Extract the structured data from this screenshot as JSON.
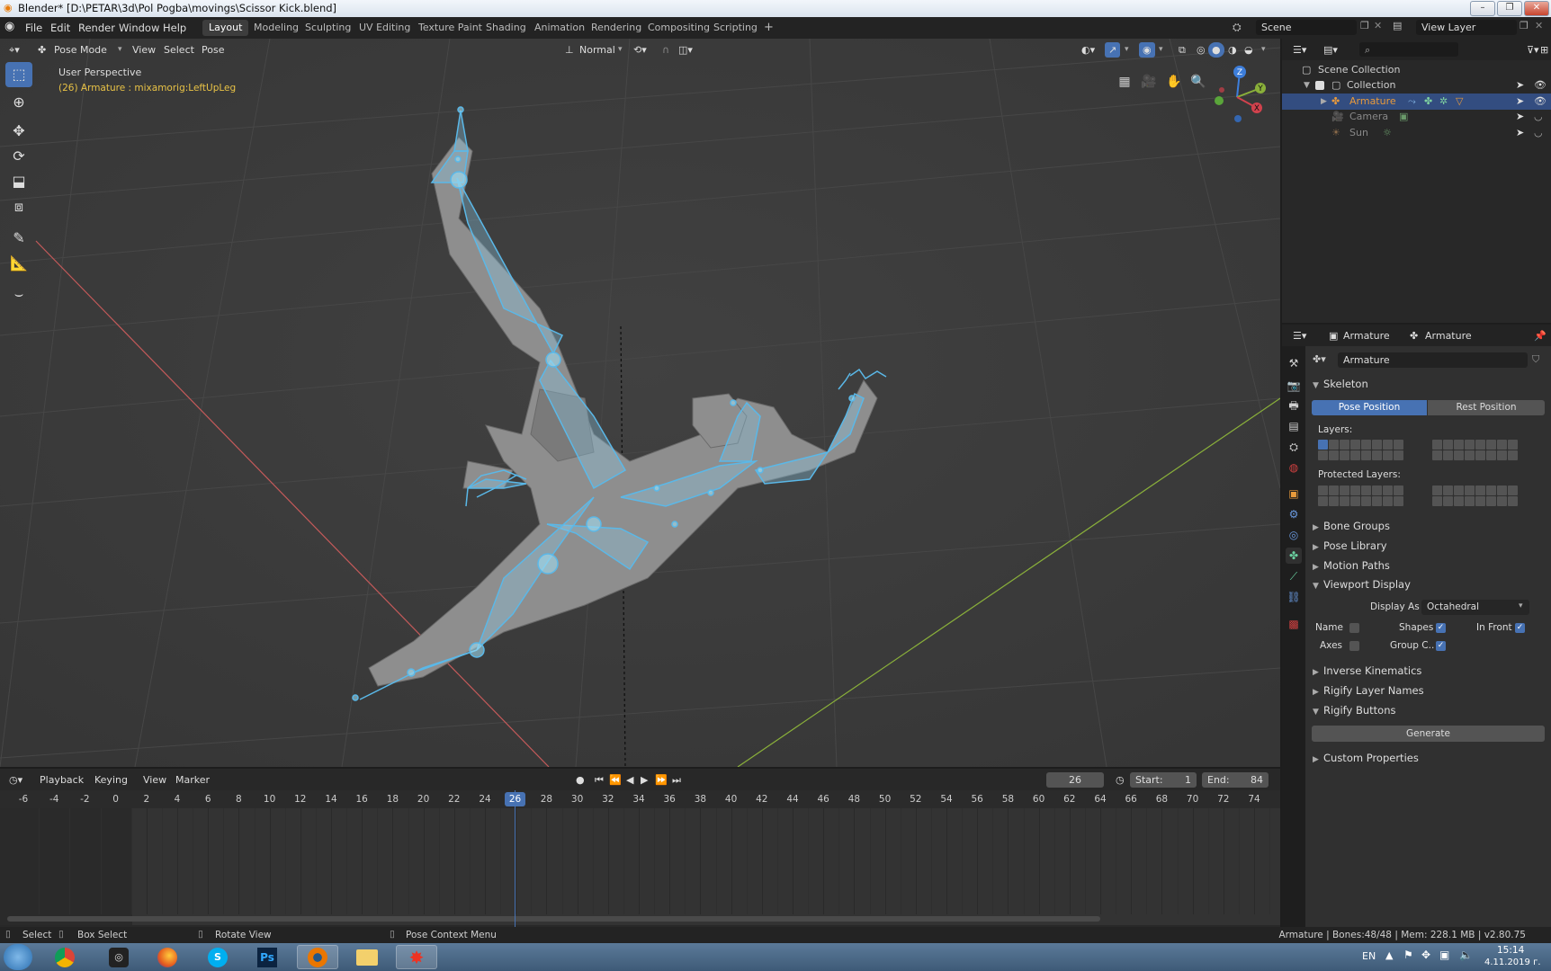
{
  "window": {
    "title": "Blender* [D:\\PETAR\\3d\\Pol Pogba\\movings\\Scissor Kick.blend]",
    "min": "–",
    "max": "❐",
    "close": "✕"
  },
  "menubar": {
    "items": [
      "File",
      "Edit",
      "Render",
      "Window",
      "Help"
    ]
  },
  "workspaces": {
    "tabs": [
      "Layout",
      "Modeling",
      "Sculpting",
      "UV Editing",
      "Texture Paint",
      "Shading",
      "Animation",
      "Rendering",
      "Compositing",
      "Scripting"
    ],
    "active": "Layout",
    "add": "+"
  },
  "scene": {
    "label": "Scene",
    "view_layer": "View Layer"
  },
  "viewport": {
    "mode": "Pose Mode",
    "menus": [
      "View",
      "Select",
      "Pose"
    ],
    "orientation": "Normal",
    "info_line1": "User Perspective",
    "info_line2": "(26) Armature : mixamorig:LeftUpLeg",
    "gizmo": {
      "z": "Z",
      "y": "Y",
      "x": "X"
    }
  },
  "outliner": {
    "search_placeholder": "",
    "rows": [
      {
        "label": "Scene Collection"
      },
      {
        "label": "Collection"
      },
      {
        "label": "Armature"
      },
      {
        "label": "Camera"
      },
      {
        "label": "Sun"
      }
    ]
  },
  "properties": {
    "header_object": "Armature",
    "header_data": "Armature",
    "datablock_name": "Armature",
    "skeleton": {
      "title": "Skeleton",
      "pose_position": "Pose Position",
      "rest_position": "Rest Position",
      "layers": "Layers:",
      "protected_layers": "Protected Layers:"
    },
    "sections_collapsed_1": [
      "Bone Groups",
      "Pose Library",
      "Motion Paths"
    ],
    "viewport_display": {
      "title": "Viewport Display",
      "display_as_label": "Display As",
      "display_as_value": "Octahedral",
      "name": "Name",
      "shapes": "Shapes",
      "in_front": "In Front",
      "axes": "Axes",
      "group_colors": "Group C..",
      "checked": {
        "name": false,
        "shapes": true,
        "in_front": true,
        "axes": false,
        "group_colors": true
      }
    },
    "sections_collapsed_2": [
      "Inverse Kinematics",
      "Rigify Layer Names"
    ],
    "rigify_buttons": {
      "title": "Rigify Buttons",
      "generate": "Generate"
    },
    "custom_properties": "Custom Properties"
  },
  "timeline": {
    "menus": [
      "Playback",
      "Keying",
      "View",
      "Marker"
    ],
    "current_frame": "26",
    "start_label": "Start:",
    "start": "1",
    "end_label": "End:",
    "end": "84",
    "ticks": [
      "-6",
      "-4",
      "-2",
      "0",
      "2",
      "4",
      "6",
      "8",
      "10",
      "12",
      "14",
      "16",
      "18",
      "20",
      "22",
      "24",
      "26",
      "28",
      "30",
      "32",
      "34",
      "36",
      "38",
      "40",
      "42",
      "44",
      "46",
      "48",
      "50",
      "52",
      "54",
      "56",
      "58",
      "60",
      "62",
      "64",
      "66",
      "68",
      "70",
      "72",
      "74"
    ]
  },
  "statusbar": {
    "select": "Select",
    "box_select": "Box Select",
    "rotate_view": "Rotate View",
    "context_menu": "Pose Context Menu",
    "stats": "Armature | Bones:48/48 | Mem: 228.1 MB | v2.80.75"
  },
  "taskbar": {
    "lang": "EN",
    "time": "15:14",
    "date": "4.11.2019 г."
  },
  "colors": {
    "accent": "#4772b3",
    "bone": "#5ab8e8",
    "x_axis": "#c45a5a",
    "y_axis": "#8ab03a"
  }
}
